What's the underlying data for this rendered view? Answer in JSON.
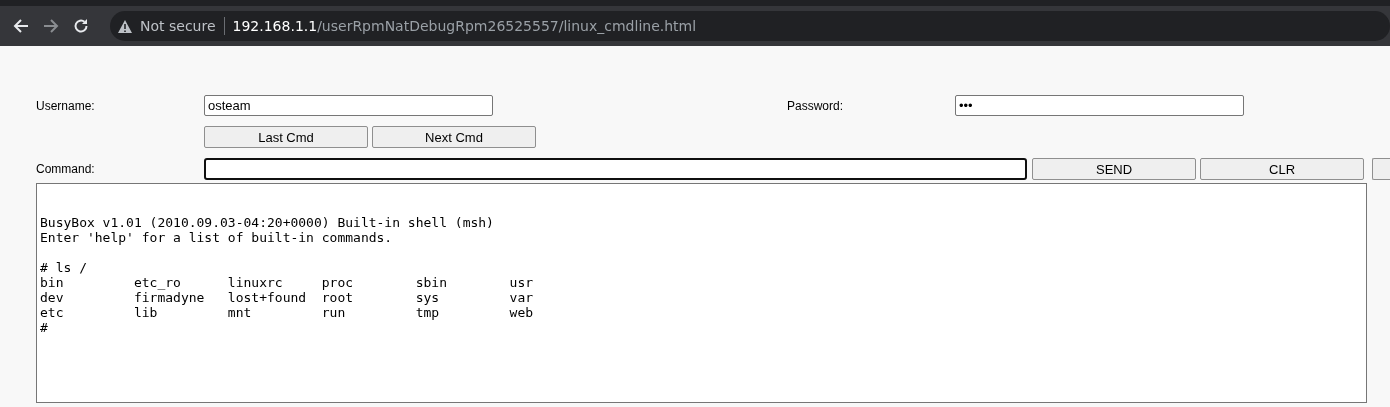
{
  "browser": {
    "security": "Not secure",
    "url_host": "192.168.1.1",
    "url_path": "/userRpmNatDebugRpm26525557/linux_cmdline.html",
    "forward_disabled": true
  },
  "form": {
    "username_label": "Username:",
    "username": "osteam",
    "password_label": "Password:",
    "password": "•••",
    "history_buttons": [
      "Last Cmd",
      "Next Cmd"
    ],
    "command_label": "Command:",
    "command_focused": true,
    "command_buttons": [
      "SEND",
      "CLR"
    ]
  },
  "terminal": {
    "output": "BusyBox v1.01 (2010.09.03-04:20+0000) Built-in shell (msh)\nEnter 'help' for a list of built-in commands.\n\n# ls /\nbin         etc_ro      linuxrc     proc        sbin        usr\ndev         firmadyne   lost+found  root        sys         var\netc         lib         mnt         run         tmp         web\n#"
  }
}
